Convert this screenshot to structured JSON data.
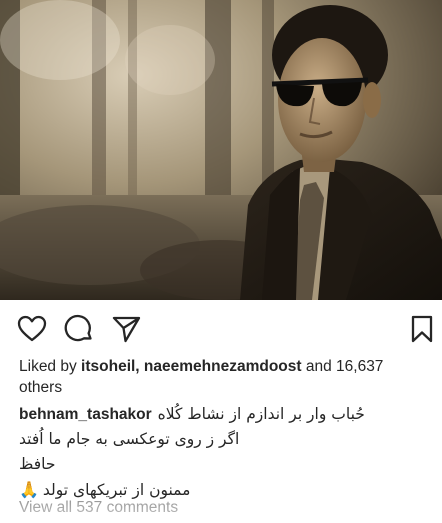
{
  "post": {
    "photo_description": "sepia portrait of man in sunglasses",
    "likes": {
      "prefix": "Liked by ",
      "users": "itsoheil, naeemehnezamdoost",
      "suffix": " and 16,637",
      "second_line": "others"
    },
    "caption": {
      "username": "behnam_tashakor",
      "line1": "حُباب وار بر اندازم از نشاط کُلاه",
      "line2": "اگر ز روی توعکسی به جام ما اُفتد",
      "line3": "حافظ",
      "line4": "ممنون از تبریکهای تولد"
    },
    "view_all_comments": "View all 537 comments"
  },
  "icons": {
    "like": "heart-icon",
    "comment": "comment-bubble-icon",
    "share": "paper-plane-icon",
    "save": "bookmark-icon"
  },
  "colors": {
    "text": "#262626",
    "muted": "#8e8e8e"
  }
}
